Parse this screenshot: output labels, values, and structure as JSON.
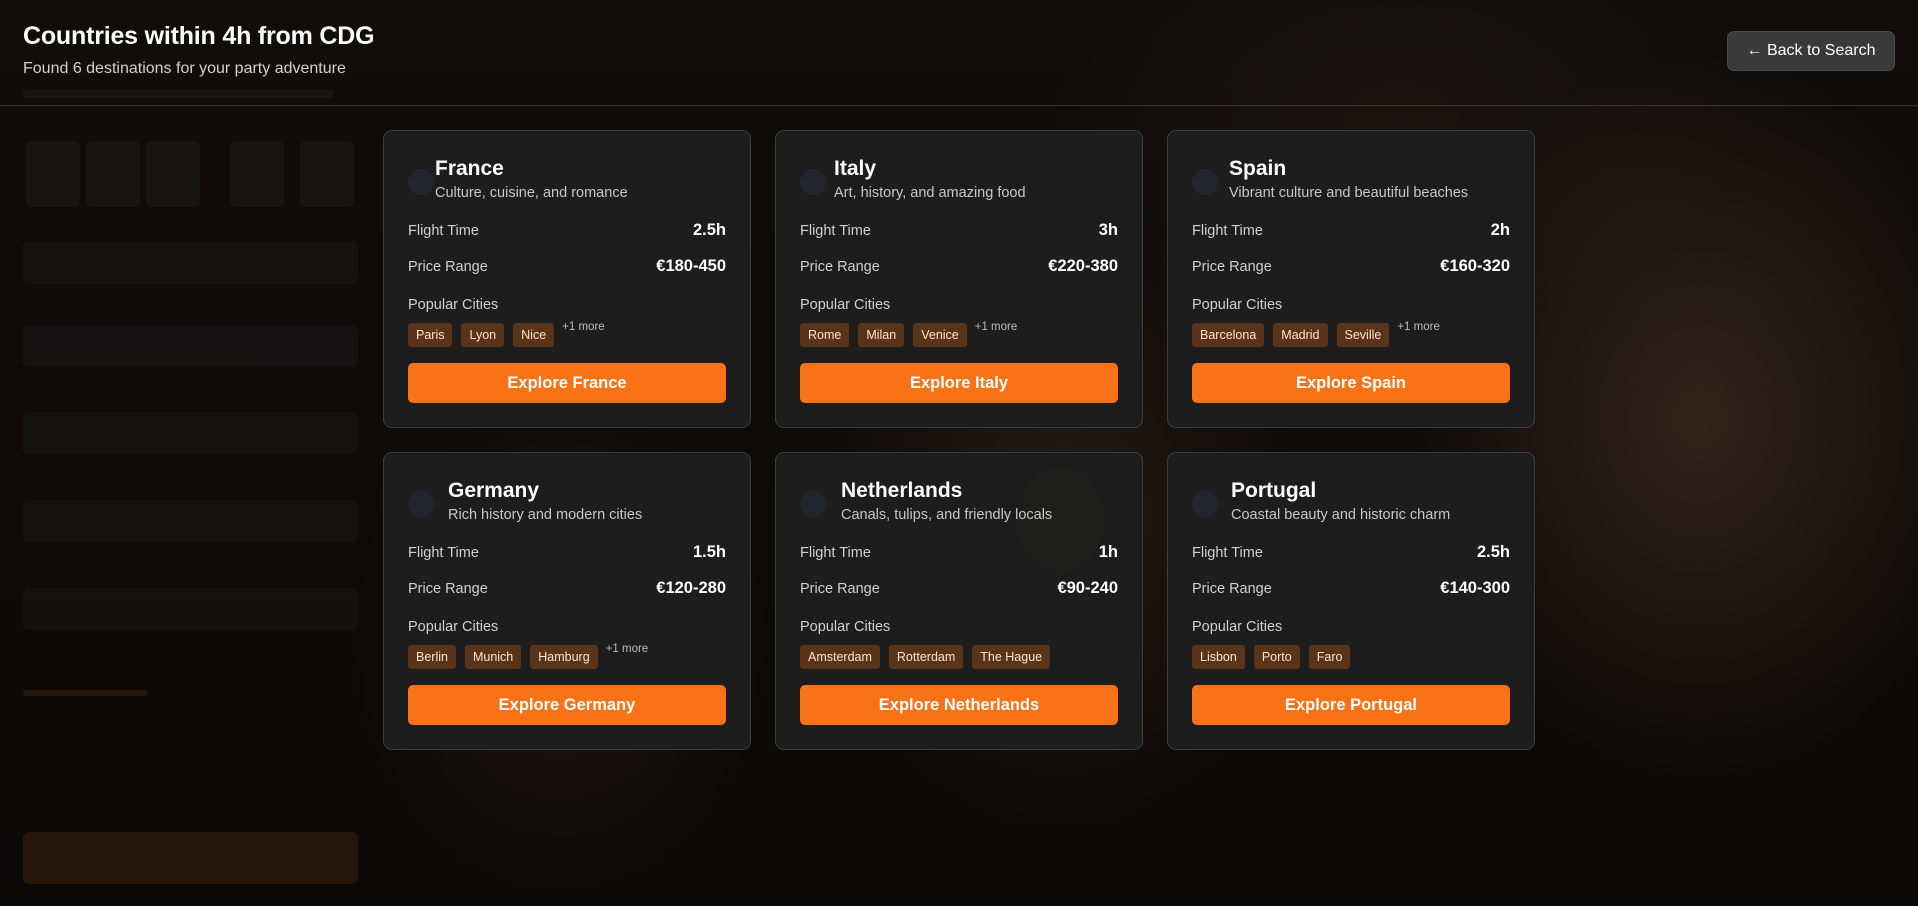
{
  "header": {
    "title": "Countries within 4h from CDG",
    "subtitle": "Found 6 destinations for your party adventure",
    "back_label": "← Back to Search"
  },
  "labels": {
    "flight_time": "Flight Time",
    "price_range": "Price Range",
    "popular_cities": "Popular Cities"
  },
  "colors": {
    "accent": "#f97316",
    "card_bg": "#1e1e1e",
    "chip_bg": "#5a3418"
  },
  "countries": [
    {
      "name": "France",
      "description": "Culture, cuisine, and romance",
      "flight_time": "2.5h",
      "price_range": "€180-450",
      "cities": [
        "Paris",
        "Lyon",
        "Nice"
      ],
      "more": "+1 more",
      "cta": "Explore France"
    },
    {
      "name": "Italy",
      "description": "Art, history, and amazing food",
      "flight_time": "3h",
      "price_range": "€220-380",
      "cities": [
        "Rome",
        "Milan",
        "Venice"
      ],
      "more": "+1 more",
      "cta": "Explore Italy"
    },
    {
      "name": "Spain",
      "description": "Vibrant culture and beautiful beaches",
      "flight_time": "2h",
      "price_range": "€160-320",
      "cities": [
        "Barcelona",
        "Madrid",
        "Seville"
      ],
      "more": "+1 more",
      "cta": "Explore Spain"
    },
    {
      "name": "Germany",
      "description": "Rich history and modern cities",
      "flight_time": "1.5h",
      "price_range": "€120-280",
      "cities": [
        "Berlin",
        "Munich",
        "Hamburg"
      ],
      "more": "+1 more",
      "cta": "Explore Germany"
    },
    {
      "name": "Netherlands",
      "description": "Canals, tulips, and friendly locals",
      "flight_time": "1h",
      "price_range": "€90-240",
      "cities": [
        "Amsterdam",
        "Rotterdam",
        "The Hague"
      ],
      "more": "",
      "cta": "Explore Netherlands"
    },
    {
      "name": "Portugal",
      "description": "Coastal beauty and historic charm",
      "flight_time": "2.5h",
      "price_range": "€140-300",
      "cities": [
        "Lisbon",
        "Porto",
        "Faro"
      ],
      "more": "",
      "cta": "Explore Portugal"
    }
  ]
}
